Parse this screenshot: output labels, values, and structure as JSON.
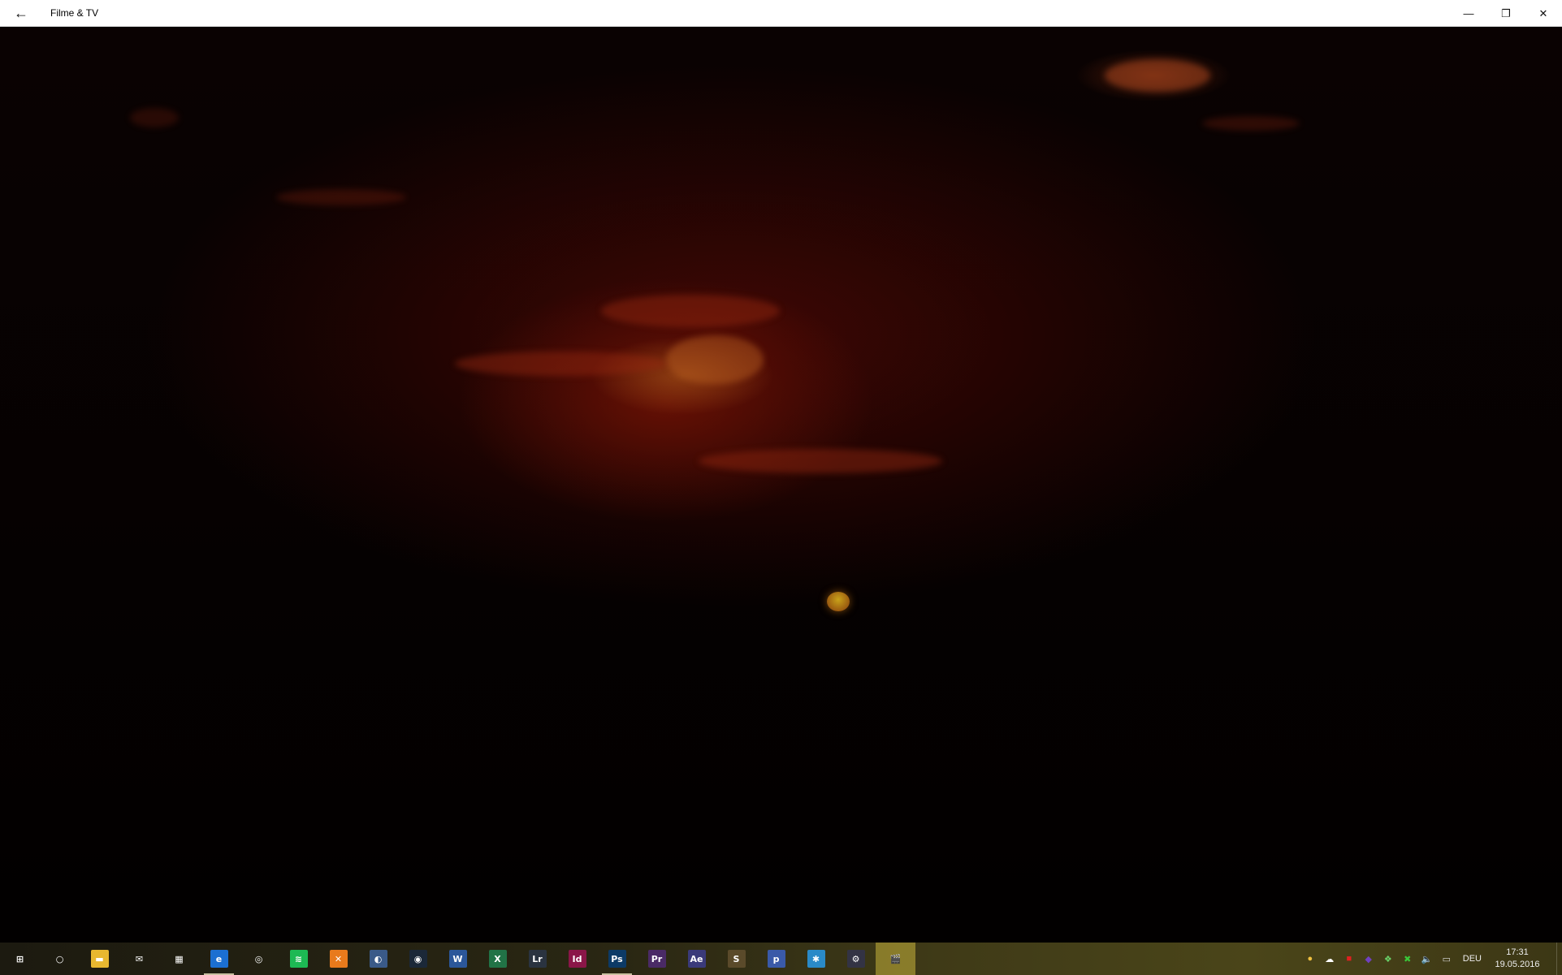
{
  "window": {
    "title": "Filme & TV",
    "back_glyph": "←",
    "minimize_glyph": "—",
    "restore_glyph": "❐",
    "close_glyph": "✕"
  },
  "taskbar": {
    "items": [
      {
        "name": "start-button",
        "icon": "windows-icon",
        "glyph": "⊞",
        "bg": "transparent"
      },
      {
        "name": "cortana-button",
        "icon": "cortana-icon",
        "glyph": "○",
        "bg": "transparent"
      },
      {
        "name": "file-explorer-button",
        "icon": "folder-icon",
        "glyph": "▬",
        "bg": "#e8b830"
      },
      {
        "name": "mail-button",
        "icon": "mail-icon",
        "glyph": "✉",
        "bg": "transparent"
      },
      {
        "name": "calendar-button",
        "icon": "calendar-icon",
        "glyph": "▦",
        "bg": "transparent"
      },
      {
        "name": "edge-button",
        "icon": "edge-icon",
        "glyph": "e",
        "bg": "#1b6fd1"
      },
      {
        "name": "groove-button",
        "icon": "groove-music-icon",
        "glyph": "◎",
        "bg": "transparent"
      },
      {
        "name": "spotify-button",
        "icon": "spotify-icon",
        "glyph": "≋",
        "bg": "#1db954"
      },
      {
        "name": "app-x-button",
        "icon": "orange-x-icon",
        "glyph": "✕",
        "bg": "#e87a1c"
      },
      {
        "name": "app-circle-button",
        "icon": "circle-app-icon",
        "glyph": "◐",
        "bg": "#3a5a88"
      },
      {
        "name": "steam-button",
        "icon": "steam-icon",
        "glyph": "◉",
        "bg": "#1b2838"
      },
      {
        "name": "word-button",
        "icon": "word-icon",
        "glyph": "W",
        "bg": "#2b579a"
      },
      {
        "name": "excel-button",
        "icon": "excel-icon",
        "glyph": "X",
        "bg": "#217346"
      },
      {
        "name": "lightroom-button",
        "icon": "lightroom-icon",
        "glyph": "Lr",
        "bg": "#2a3340"
      },
      {
        "name": "indesign-button",
        "icon": "indesign-icon",
        "glyph": "Id",
        "bg": "#8a1648"
      },
      {
        "name": "photoshop-button",
        "icon": "photoshop-icon",
        "glyph": "Ps",
        "bg": "#0c3a66"
      },
      {
        "name": "premiere-button",
        "icon": "premiere-icon",
        "glyph": "Pr",
        "bg": "#4a2a66"
      },
      {
        "name": "after-effects-button",
        "icon": "after-effects-icon",
        "glyph": "Ae",
        "bg": "#3a3a7a"
      },
      {
        "name": "sublime-button",
        "icon": "sublime-icon",
        "glyph": "S",
        "bg": "#5a4a2a"
      },
      {
        "name": "app-php-button",
        "icon": "php-app-icon",
        "glyph": "p",
        "bg": "#3a5aa8"
      },
      {
        "name": "snowflake-app-button",
        "icon": "snowflake-icon",
        "glyph": "✱",
        "bg": "#2a8ac8"
      },
      {
        "name": "settings-app-button",
        "icon": "app-gear-icon",
        "glyph": "⚙",
        "bg": "#334"
      },
      {
        "name": "movies-tv-button",
        "icon": "clapperboard-icon",
        "glyph": "🎬",
        "bg": "transparent"
      }
    ],
    "running": [
      5,
      15
    ],
    "active_index": 22
  },
  "tray": {
    "icons": [
      {
        "name": "chrome-tray-icon",
        "glyph": "●",
        "color": "#f0c040"
      },
      {
        "name": "onedrive-icon",
        "glyph": "☁",
        "color": "#ffffff"
      },
      {
        "name": "red-app-tray-icon",
        "glyph": "■",
        "color": "#e02020"
      },
      {
        "name": "purple-app-tray-icon",
        "glyph": "◆",
        "color": "#7040c0"
      },
      {
        "name": "dropbox-icon",
        "glyph": "❖",
        "color": "#6ad46a"
      },
      {
        "name": "xbox-tray-icon",
        "glyph": "✖",
        "color": "#3ac83a"
      },
      {
        "name": "volume-icon",
        "glyph": "🔈",
        "color": "#dddddd"
      },
      {
        "name": "notification-icon",
        "glyph": "▭",
        "color": "#dddddd"
      }
    ],
    "language": "DEU",
    "time": "17:31",
    "date": "19.05.2016"
  }
}
